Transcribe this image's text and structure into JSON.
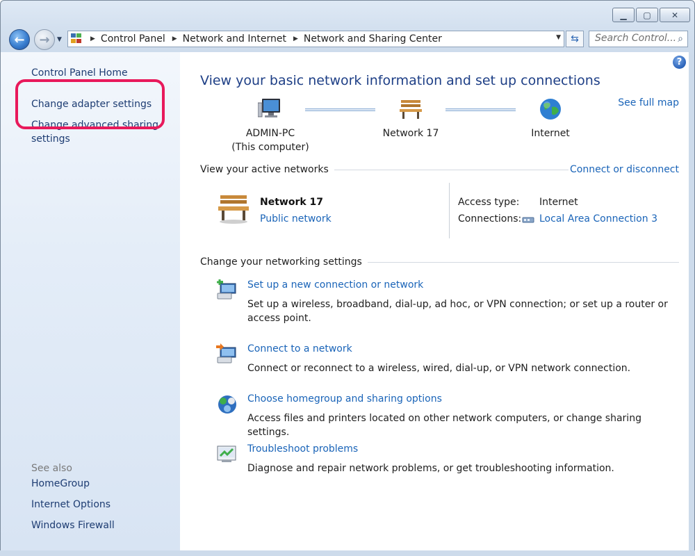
{
  "window": {
    "controls": {
      "minimize": "▁",
      "maximize": "▢",
      "close": "✕"
    }
  },
  "navigation": {
    "back_icon": "back-arrow-icon",
    "forward_icon": "forward-arrow-icon",
    "breadcrumbs": [
      "Control Panel",
      "Network and Internet",
      "Network and Sharing Center"
    ],
    "search_placeholder": "Search Control..."
  },
  "sidebar": {
    "home": "Control Panel Home",
    "links": [
      "Change adapter settings",
      "Change advanced sharing settings"
    ],
    "see_also_label": "See also",
    "see_also": [
      "HomeGroup",
      "Internet Options",
      "Windows Firewall"
    ],
    "highlight_color": "#e8195b"
  },
  "main": {
    "title": "View your basic network information and set up connections",
    "see_full_map": "See full map",
    "map_nodes": [
      {
        "name": "ADMIN-PC",
        "sub": "(This computer)",
        "icon": "computer-icon"
      },
      {
        "name": "Network  17",
        "sub": "",
        "icon": "bench-icon"
      },
      {
        "name": "Internet",
        "sub": "",
        "icon": "globe-icon"
      }
    ],
    "active_networks": {
      "header": "View your active networks",
      "connect_or_disconnect": "Connect or disconnect",
      "network_name": "Network  17",
      "network_category": "Public network",
      "access_type_label": "Access type:",
      "access_type_value": "Internet",
      "connections_label": "Connections:",
      "connections_value": "Local Area Connection 3"
    },
    "settings": {
      "header": "Change your networking settings",
      "tasks": [
        {
          "icon": "new-connection-icon",
          "link": "Set up a new connection or network",
          "desc": "Set up a wireless, broadband, dial-up, ad hoc, or VPN connection; or set up a router or access point."
        },
        {
          "icon": "connect-network-icon",
          "link": "Connect to a network",
          "desc": "Connect or reconnect to a wireless, wired, dial-up, or VPN network connection."
        },
        {
          "icon": "homegroup-icon",
          "link": "Choose homegroup and sharing options",
          "desc": "Access files and printers located on other network computers, or change sharing settings."
        },
        {
          "icon": "troubleshoot-icon",
          "link": "Troubleshoot problems",
          "desc": "Diagnose and repair network problems, or get troubleshooting information."
        }
      ]
    }
  },
  "colors": {
    "link": "#1a64b8",
    "title": "#1e3f86",
    "sidebar_link": "#1d3c72"
  }
}
